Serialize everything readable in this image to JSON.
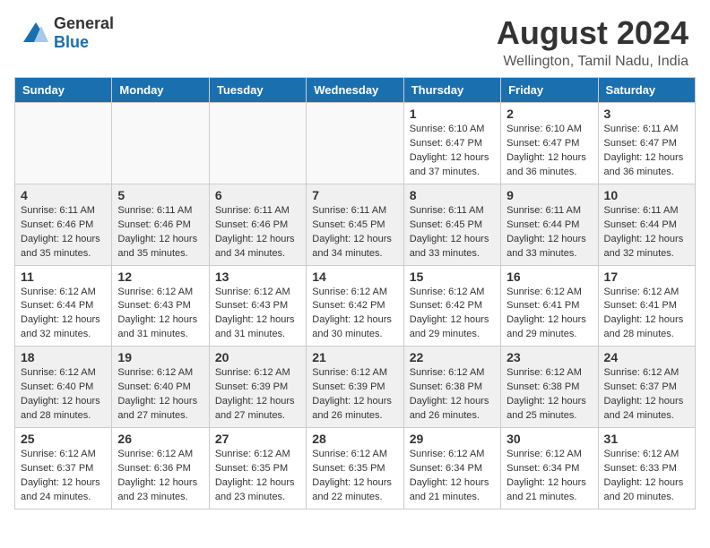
{
  "header": {
    "logo_general": "General",
    "logo_blue": "Blue",
    "month_year": "August 2024",
    "location": "Wellington, Tamil Nadu, India"
  },
  "days_of_week": [
    "Sunday",
    "Monday",
    "Tuesday",
    "Wednesday",
    "Thursday",
    "Friday",
    "Saturday"
  ],
  "weeks": [
    [
      {
        "day": "",
        "info": ""
      },
      {
        "day": "",
        "info": ""
      },
      {
        "day": "",
        "info": ""
      },
      {
        "day": "",
        "info": ""
      },
      {
        "day": "1",
        "info": "Sunrise: 6:10 AM\nSunset: 6:47 PM\nDaylight: 12 hours\nand 37 minutes."
      },
      {
        "day": "2",
        "info": "Sunrise: 6:10 AM\nSunset: 6:47 PM\nDaylight: 12 hours\nand 36 minutes."
      },
      {
        "day": "3",
        "info": "Sunrise: 6:11 AM\nSunset: 6:47 PM\nDaylight: 12 hours\nand 36 minutes."
      }
    ],
    [
      {
        "day": "4",
        "info": "Sunrise: 6:11 AM\nSunset: 6:46 PM\nDaylight: 12 hours\nand 35 minutes."
      },
      {
        "day": "5",
        "info": "Sunrise: 6:11 AM\nSunset: 6:46 PM\nDaylight: 12 hours\nand 35 minutes."
      },
      {
        "day": "6",
        "info": "Sunrise: 6:11 AM\nSunset: 6:46 PM\nDaylight: 12 hours\nand 34 minutes."
      },
      {
        "day": "7",
        "info": "Sunrise: 6:11 AM\nSunset: 6:45 PM\nDaylight: 12 hours\nand 34 minutes."
      },
      {
        "day": "8",
        "info": "Sunrise: 6:11 AM\nSunset: 6:45 PM\nDaylight: 12 hours\nand 33 minutes."
      },
      {
        "day": "9",
        "info": "Sunrise: 6:11 AM\nSunset: 6:44 PM\nDaylight: 12 hours\nand 33 minutes."
      },
      {
        "day": "10",
        "info": "Sunrise: 6:11 AM\nSunset: 6:44 PM\nDaylight: 12 hours\nand 32 minutes."
      }
    ],
    [
      {
        "day": "11",
        "info": "Sunrise: 6:12 AM\nSunset: 6:44 PM\nDaylight: 12 hours\nand 32 minutes."
      },
      {
        "day": "12",
        "info": "Sunrise: 6:12 AM\nSunset: 6:43 PM\nDaylight: 12 hours\nand 31 minutes."
      },
      {
        "day": "13",
        "info": "Sunrise: 6:12 AM\nSunset: 6:43 PM\nDaylight: 12 hours\nand 31 minutes."
      },
      {
        "day": "14",
        "info": "Sunrise: 6:12 AM\nSunset: 6:42 PM\nDaylight: 12 hours\nand 30 minutes."
      },
      {
        "day": "15",
        "info": "Sunrise: 6:12 AM\nSunset: 6:42 PM\nDaylight: 12 hours\nand 29 minutes."
      },
      {
        "day": "16",
        "info": "Sunrise: 6:12 AM\nSunset: 6:41 PM\nDaylight: 12 hours\nand 29 minutes."
      },
      {
        "day": "17",
        "info": "Sunrise: 6:12 AM\nSunset: 6:41 PM\nDaylight: 12 hours\nand 28 minutes."
      }
    ],
    [
      {
        "day": "18",
        "info": "Sunrise: 6:12 AM\nSunset: 6:40 PM\nDaylight: 12 hours\nand 28 minutes."
      },
      {
        "day": "19",
        "info": "Sunrise: 6:12 AM\nSunset: 6:40 PM\nDaylight: 12 hours\nand 27 minutes."
      },
      {
        "day": "20",
        "info": "Sunrise: 6:12 AM\nSunset: 6:39 PM\nDaylight: 12 hours\nand 27 minutes."
      },
      {
        "day": "21",
        "info": "Sunrise: 6:12 AM\nSunset: 6:39 PM\nDaylight: 12 hours\nand 26 minutes."
      },
      {
        "day": "22",
        "info": "Sunrise: 6:12 AM\nSunset: 6:38 PM\nDaylight: 12 hours\nand 26 minutes."
      },
      {
        "day": "23",
        "info": "Sunrise: 6:12 AM\nSunset: 6:38 PM\nDaylight: 12 hours\nand 25 minutes."
      },
      {
        "day": "24",
        "info": "Sunrise: 6:12 AM\nSunset: 6:37 PM\nDaylight: 12 hours\nand 24 minutes."
      }
    ],
    [
      {
        "day": "25",
        "info": "Sunrise: 6:12 AM\nSunset: 6:37 PM\nDaylight: 12 hours\nand 24 minutes."
      },
      {
        "day": "26",
        "info": "Sunrise: 6:12 AM\nSunset: 6:36 PM\nDaylight: 12 hours\nand 23 minutes."
      },
      {
        "day": "27",
        "info": "Sunrise: 6:12 AM\nSunset: 6:35 PM\nDaylight: 12 hours\nand 23 minutes."
      },
      {
        "day": "28",
        "info": "Sunrise: 6:12 AM\nSunset: 6:35 PM\nDaylight: 12 hours\nand 22 minutes."
      },
      {
        "day": "29",
        "info": "Sunrise: 6:12 AM\nSunset: 6:34 PM\nDaylight: 12 hours\nand 21 minutes."
      },
      {
        "day": "30",
        "info": "Sunrise: 6:12 AM\nSunset: 6:34 PM\nDaylight: 12 hours\nand 21 minutes."
      },
      {
        "day": "31",
        "info": "Sunrise: 6:12 AM\nSunset: 6:33 PM\nDaylight: 12 hours\nand 20 minutes."
      }
    ]
  ]
}
